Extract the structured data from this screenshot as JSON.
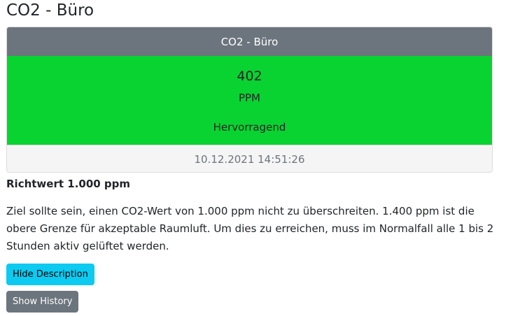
{
  "page": {
    "title": "CO2 - Büro"
  },
  "card": {
    "header": "CO2 - Büro",
    "value": "402",
    "unit": "PPM",
    "rating": "Hervorragend",
    "timestamp": "10.12.2021 14:51:26",
    "status_color": "#09d331"
  },
  "guide": {
    "title": "Richtwert 1.000 ppm",
    "description": "Ziel sollte sein, einen CO2-Wert von 1.000 ppm nicht zu überschreiten. 1.400 ppm ist die obere Grenze für akzeptable Raumluft. Um dies zu erreichen, muss im Normalfall alle 1 bis 2 Stunden aktiv gelüftet werden."
  },
  "buttons": {
    "hide_description": "Hide Description",
    "show_history": "Show History"
  },
  "colors": {
    "header": "#6c757d",
    "info_button": "#0dcaf0",
    "secondary_button": "#6c757d"
  }
}
